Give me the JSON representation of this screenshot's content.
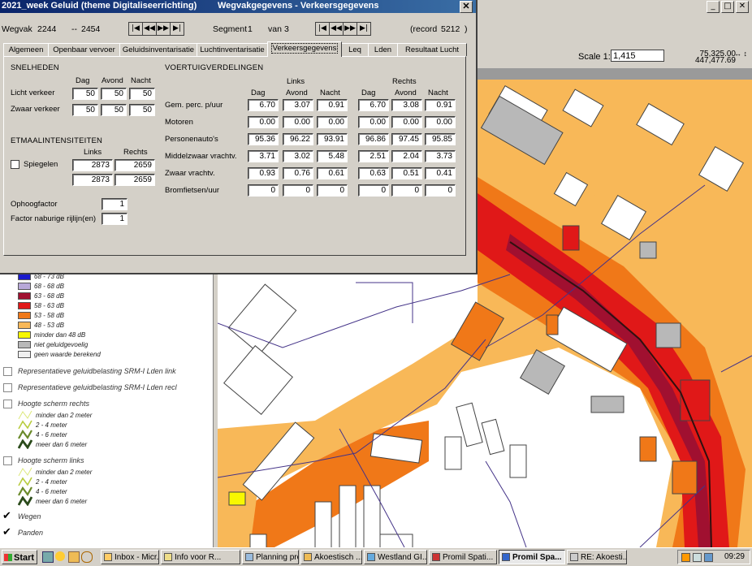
{
  "dialog": {
    "app_title": "2021_week Geluid (theme Digitaliseerrichting)",
    "window_title": "Wegvakgegevens - Verkeersgegevens",
    "close_glyph": "✕",
    "wegvak_label": "Wegvak",
    "wegvak_value": "2244",
    "wegvak_sep": "--",
    "wegvak_value2": "2454",
    "segment_label": "Segment",
    "segment_value": "1",
    "van_label": "van",
    "segment_total": "3",
    "record_label": "(record",
    "record_value": "5212",
    "record_close": ")",
    "nav_glyphs": [
      "|◀",
      "◀◀",
      "▶▶",
      "▶|"
    ],
    "tabs": [
      "Algemeen",
      "Openbaar vervoer",
      "Geluidsinventarisatie",
      "Luchtinventarisatie",
      "Verkeersgegevens",
      "Leq",
      "Lden",
      "Resultaat Lucht"
    ],
    "active_tab": "Verkeersgegevens",
    "snelheden": {
      "title": "SNELHEDEN",
      "cols": [
        "Dag",
        "Avond",
        "Nacht"
      ],
      "licht_label": "Licht verkeer",
      "licht": [
        "50",
        "50",
        "50"
      ],
      "zwaar_label": "Zwaar verkeer",
      "zwaar": [
        "50",
        "50",
        "50"
      ]
    },
    "etmaal": {
      "title": "ETMAALINTENSITEITEN",
      "links_label": "Links",
      "rechts_label": "Rechts",
      "spiegelen_label": "Spiegelen",
      "row1": [
        "2873",
        "2659"
      ],
      "row2": [
        "2873",
        "2659"
      ]
    },
    "ophoogfactor_label": "Ophoogfactor",
    "ophoogfactor": "1",
    "factor_label": "Factor naburige rijlijn(en)",
    "factor": "1",
    "voertuig": {
      "title": "VOERTUIGVERDELINGEN",
      "links_label": "Links",
      "rechts_label": "Rechts",
      "cols": [
        "Dag",
        "Avond",
        "Nacht",
        "Dag",
        "Avond",
        "Nacht"
      ],
      "rows": [
        {
          "label": "Gem. perc. p/uur",
          "values": [
            "6.70",
            "3.07",
            "0.91",
            "6.70",
            "3.08",
            "0.91"
          ]
        },
        {
          "label": "Motoren",
          "values": [
            "0.00",
            "0.00",
            "0.00",
            "0.00",
            "0.00",
            "0.00"
          ]
        },
        {
          "label": "Personenauto's",
          "values": [
            "95.36",
            "96.22",
            "93.91",
            "96.86",
            "97.45",
            "95.85"
          ]
        },
        {
          "label": "Middelzwaar vrachtv.",
          "values": [
            "3.71",
            "3.02",
            "5.48",
            "2.51",
            "2.04",
            "3.73"
          ]
        },
        {
          "label": "Zwaar vrachtv.",
          "values": [
            "0.93",
            "0.76",
            "0.61",
            "0.63",
            "0.51",
            "0.41"
          ]
        },
        {
          "label": "Bromfietsen/uur",
          "values": [
            "0",
            "0",
            "0",
            "0",
            "0",
            "0"
          ]
        }
      ]
    }
  },
  "app": {
    "win_btns": [
      "_",
      "□",
      "✕"
    ],
    "scale_label": "Scale 1:",
    "scale_value": "1,415",
    "coord_x": "75,325.00",
    "coord_y": "447,477.69",
    "coord_arrows": "↔ ↕"
  },
  "legend": {
    "classes": [
      {
        "label": "68 - 73 dB",
        "color": "#1a1acc"
      },
      {
        "label": "68 - 68 dB",
        "color": "#b8a8d8"
      },
      {
        "label": "63 - 68 dB",
        "color": "#a01030"
      },
      {
        "label": "58 - 63 dB",
        "color": "#e01818"
      },
      {
        "label": "53 - 58 dB",
        "color": "#f07818"
      },
      {
        "label": "48 - 53 dB",
        "color": "#f8b858"
      },
      {
        "label": "minder dan 48 dB",
        "color": "#f8f800"
      },
      {
        "label": "niet geluidgevoelig",
        "color": "#b8b8b8"
      },
      {
        "label": "geen waarde berekend",
        "color": "#f0f0f0"
      }
    ],
    "layer1": "Representatieve geluidbelasting SRM-I Lden link",
    "layer2": "Representatieve geluidbelasting SRM-I Lden recl",
    "scherm_rechts_title": "Hoogte scherm rechts",
    "scherm_links_title": "Hoogte scherm links",
    "scherm_items": [
      "minder dan 2 meter",
      "2 - 4 meter",
      "4 - 6 meter",
      "meer dan 6 meter"
    ],
    "wegen_label": "Wegen",
    "panden_label": "Panden",
    "check_glyph": "✔"
  },
  "taskbar": {
    "start_label": "Start",
    "items": [
      "Inbox - Micr...",
      "Info voor R...",
      "Planning pro...",
      "Akoestisch ...",
      "Westland GI...",
      "Promil Spati...",
      "Promil Spa...",
      "RE: Akoesti..."
    ],
    "active_item": "Promil Spa...",
    "clock": "09:29"
  }
}
